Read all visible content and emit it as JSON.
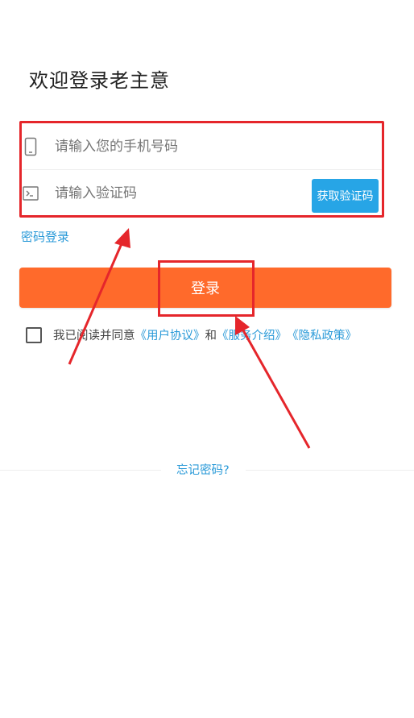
{
  "header": {
    "title": "欢迎登录老主意"
  },
  "form": {
    "phone_placeholder": "请输入您的手机号码",
    "code_placeholder": "请输入验证码",
    "get_code_label": "获取验证码",
    "password_login_label": "密码登录",
    "login_label": "登录"
  },
  "agreement": {
    "prefix": "我已阅读并同意",
    "user_agreement": "《用户协议》",
    "and": "和",
    "service_intro": "《服务介绍》",
    "privacy_policy": "《隐私政策》"
  },
  "footer": {
    "forgot_password": "忘记密码?"
  },
  "colors": {
    "accent_orange": "#ff6a2b",
    "link_blue": "#2a9ad8",
    "code_button_blue": "#27a5e6",
    "annotation_red": "#e5262b"
  },
  "icons": {
    "phone": "phone-icon",
    "code": "terminal-icon"
  }
}
